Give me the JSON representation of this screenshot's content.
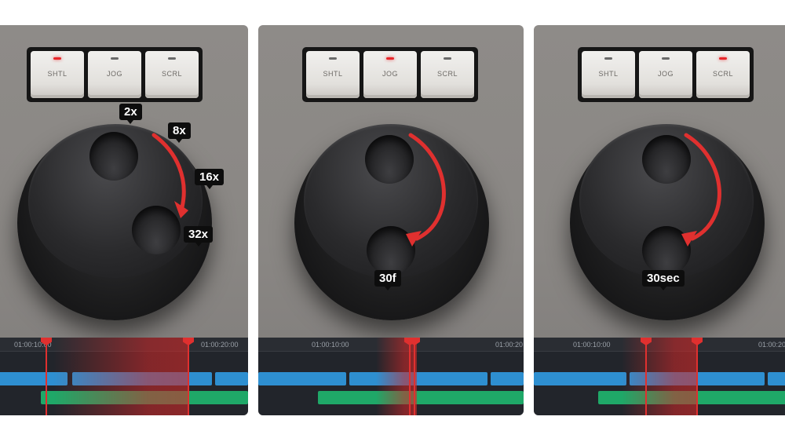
{
  "panels": [
    {
      "mode_keys": [
        "SHTL",
        "JOG",
        "SCRL"
      ],
      "active_key": 0,
      "speed_labels": [
        "2x",
        "8x",
        "16x",
        "32x"
      ],
      "timecodes": [
        "01:00:10:00",
        "01:00:20:00"
      ]
    },
    {
      "mode_keys": [
        "SHTL",
        "JOG",
        "SCRL"
      ],
      "active_key": 1,
      "speed_labels": [
        "30f"
      ],
      "timecodes": [
        "01:00:10:00",
        "01:00:20"
      ]
    },
    {
      "mode_keys": [
        "SHTL",
        "JOG",
        "SCRL"
      ],
      "active_key": 2,
      "speed_labels": [
        "30sec"
      ],
      "timecodes": [
        "01:00:10:00",
        "01:00:20"
      ]
    }
  ],
  "colors": {
    "accent_red": "#e0302f",
    "clip_blue": "#2e8fd0",
    "clip_green": "#1fa868",
    "key_face": "#e8e6e2",
    "dial": "#2a2a2c"
  },
  "icons": [
    "led-indicator",
    "curved-arrow",
    "playhead-marker"
  ]
}
